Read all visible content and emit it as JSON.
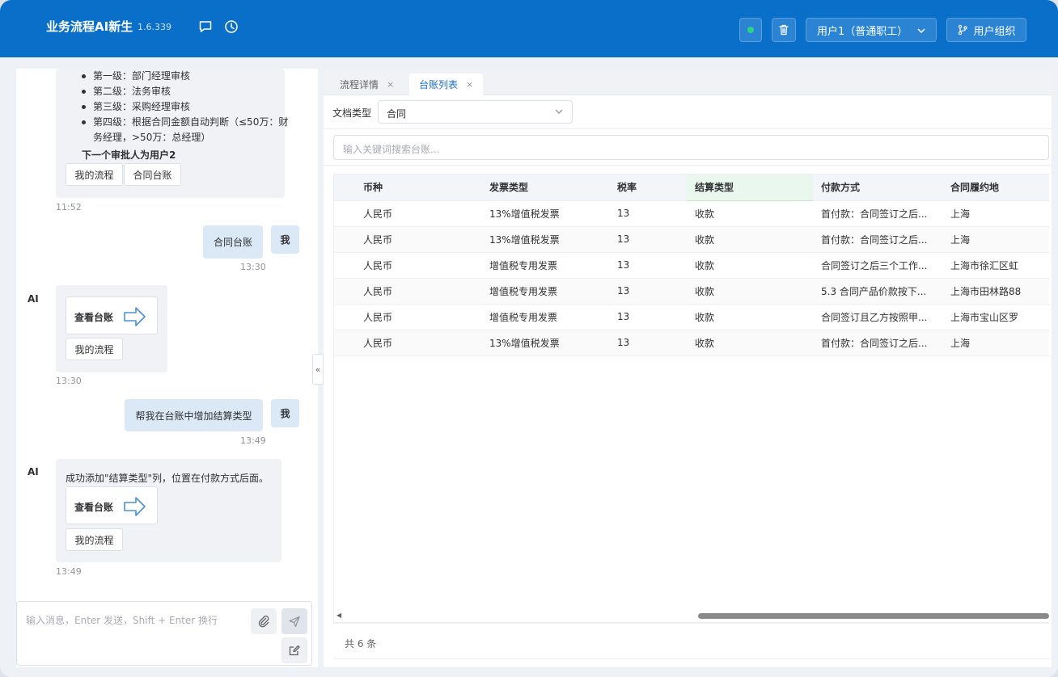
{
  "header": {
    "app_title": "业务流程AI新生",
    "version": "1.6.339",
    "user_select_label": "用户1（普通职工）",
    "user_org_label": "用户组织",
    "icons": {
      "chat": "chat-bubble-icon",
      "history": "clock-icon",
      "delete": "trash-icon",
      "org": "branch-icon"
    }
  },
  "chat": {
    "messages": [
      {
        "role": "ai",
        "levels": [
          "第一级：部门经理审核",
          "第二级：法务审核",
          "第三级：采购经理审核",
          "第四级：根据合同金额自动判断（≤50万：财务经理，>50万：总经理）"
        ],
        "next_approver": "下一个审批人为用户2",
        "buttons": [
          "我的流程",
          "合同台账"
        ],
        "time": "11:52"
      },
      {
        "role": "user",
        "avatar": "我",
        "text": "合同台账",
        "time": "13:30"
      },
      {
        "role": "ai",
        "avatar": "AI",
        "card_label": "查看台账",
        "button": "我的流程",
        "time": "13:30"
      },
      {
        "role": "user",
        "avatar": "我",
        "text": "帮我在台账中增加结算类型",
        "time": "13:49"
      },
      {
        "role": "ai",
        "avatar": "AI",
        "text": "成功添加\"结算类型\"列，位置在付款方式后面。",
        "card_label": "查看台账",
        "button": "我的流程",
        "time": "13:49"
      }
    ],
    "input_placeholder": "输入消息，Enter 发送，Shift + Enter 换行",
    "collapse_glyph": "«"
  },
  "tabs": [
    {
      "label": "流程详情",
      "close": "×",
      "active": false
    },
    {
      "label": "台账列表",
      "close": "×",
      "active": true
    }
  ],
  "filter": {
    "label": "文档类型",
    "selected": "合同",
    "search_placeholder": "输入关键词搜索台账..."
  },
  "table": {
    "columns": [
      "币种",
      "发票类型",
      "税率",
      "结算类型",
      "付款方式",
      "合同履约地"
    ],
    "rows": [
      [
        "人民币",
        "13%增值税发票",
        "13",
        "收款",
        "首付款：合同签订之后...",
        "上海"
      ],
      [
        "人民币",
        "13%增值税发票",
        "13",
        "收款",
        "首付款：合同签订之后...",
        "上海"
      ],
      [
        "人民币",
        "增值税专用发票",
        "13",
        "收款",
        "合同签订之后三个工作...",
        "上海市徐汇区虹"
      ],
      [
        "人民币",
        "增值税专用发票",
        "13",
        "收款",
        "5.3 合同产品价款按下...",
        "上海市田林路88"
      ],
      [
        "人民币",
        "增值税专用发票",
        "13",
        "收款",
        "合同签订且乙方按照甲...",
        "上海市宝山区罗"
      ],
      [
        "人民币",
        "13%增值税发票",
        "13",
        "收款",
        "首付款：合同签订之后...",
        "上海"
      ]
    ],
    "total_text": "共 6 条"
  },
  "colors": {
    "header_bg": "#0a6fc8",
    "accent": "#1a6fc4",
    "status_online": "#2fd08a"
  }
}
